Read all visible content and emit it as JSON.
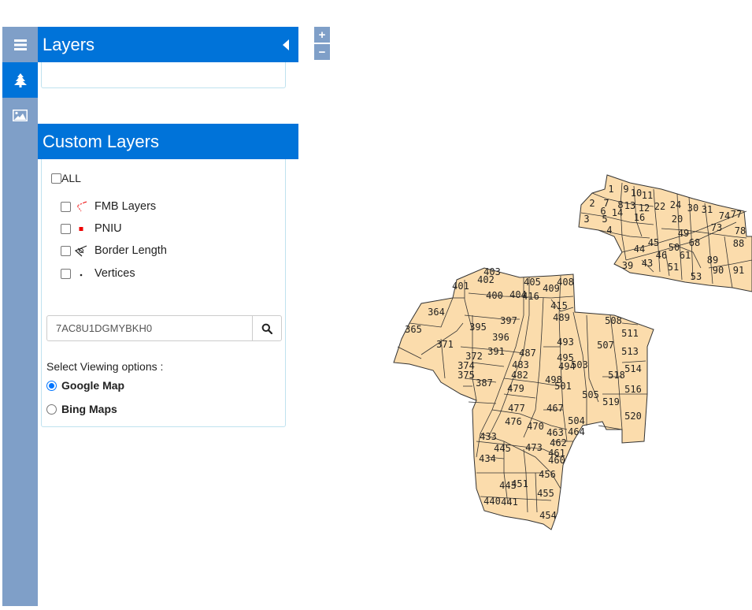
{
  "rail": {
    "items": [
      {
        "name": "menu",
        "icon": "hamburger-icon"
      },
      {
        "name": "layers",
        "icon": "tree-icon",
        "active": true
      },
      {
        "name": "basemap",
        "icon": "image-icon"
      }
    ]
  },
  "layers_panel": {
    "title": "Layers",
    "collapse_icon": "caret-left-icon"
  },
  "custom_layers": {
    "title": "Custom Layers",
    "all_label": "ALL",
    "items": [
      {
        "label": "FMB Layers",
        "icon": "fmb-line-icon",
        "checked": false
      },
      {
        "label": "PNIU",
        "icon": "red-square-icon",
        "checked": false
      },
      {
        "label": "Border Length",
        "icon": "border-length-icon",
        "checked": false
      },
      {
        "label": "Vertices",
        "icon": "dot-icon",
        "checked": false
      }
    ],
    "search": {
      "value": "7AC8U1DGMYBKH0",
      "icon": "search-icon"
    },
    "viewing_label": "Select Viewing options :",
    "viewing_options": [
      {
        "label": "Google Map",
        "selected": true
      },
      {
        "label": "Bing Maps",
        "selected": false
      }
    ]
  },
  "map_controls": {
    "zoom_in": "+",
    "zoom_out": "−"
  },
  "colors": {
    "accent": "#0073d9",
    "rail": "#7f9fc8",
    "parcel_fill": "#fbdcac",
    "parcel_stroke": "#333333"
  },
  "map": {
    "parcel_labels": [
      "1",
      "9",
      "10",
      "11",
      "2",
      "7",
      "8",
      "13",
      "12",
      "22",
      "24",
      "30",
      "31",
      "6",
      "14",
      "16",
      "3",
      "5",
      "20",
      "74",
      "77",
      "4",
      "73",
      "78",
      "49",
      "88",
      "45",
      "50",
      "68",
      "44",
      "46",
      "61",
      "89",
      "43",
      "51",
      "90",
      "91",
      "39",
      "53",
      "403",
      "402",
      "405",
      "416",
      "400",
      "401",
      "404",
      "409",
      "408",
      "415",
      "364",
      "395",
      "397",
      "489",
      "396",
      "493",
      "371",
      "365",
      "372",
      "391",
      "487",
      "495",
      "494",
      "503",
      "507",
      "508",
      "511",
      "513",
      "514",
      "518",
      "516",
      "519",
      "520",
      "374",
      "375",
      "483",
      "482",
      "479",
      "387",
      "501",
      "498",
      "505",
      "477",
      "476",
      "470",
      "467",
      "504",
      "464",
      "463",
      "462",
      "433",
      "473",
      "445",
      "434",
      "461",
      "460",
      "441",
      "443",
      "451",
      "454",
      "455",
      "456",
      "440"
    ]
  }
}
